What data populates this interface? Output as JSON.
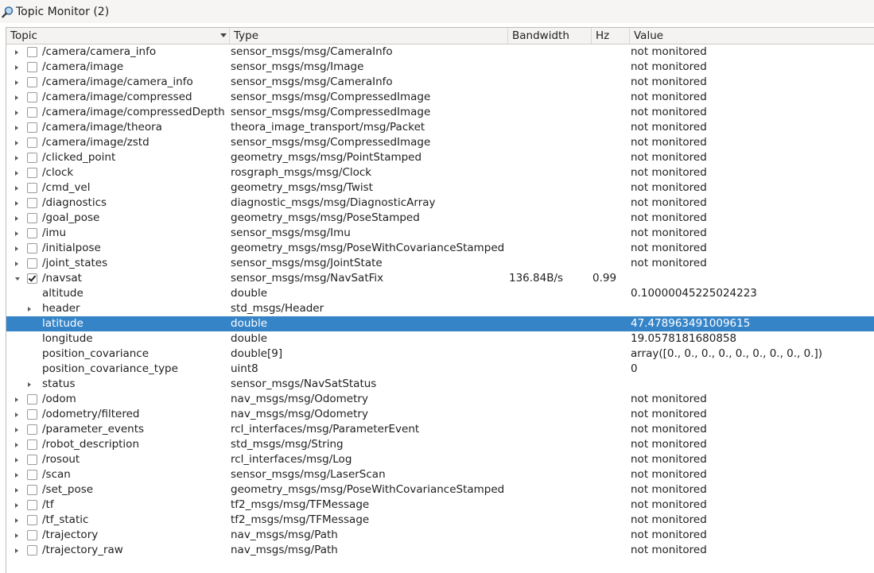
{
  "window": {
    "title": "Topic Monitor (2)",
    "icon": "magnifier-icon"
  },
  "columns": {
    "topic": "Topic",
    "type": "Type",
    "bandwidth": "Bandwidth",
    "hz": "Hz",
    "value": "Value"
  },
  "colors": {
    "selection": "#3584c8",
    "header_bg": "#f4f3f2"
  },
  "rows": [
    {
      "kind": "topic",
      "expand": "collapsed",
      "checked": false,
      "name": "/camera/camera_info",
      "type": "sensor_msgs/msg/CameraInfo",
      "bw": "",
      "hz": "",
      "value": "not monitored"
    },
    {
      "kind": "topic",
      "expand": "collapsed",
      "checked": false,
      "name": "/camera/image",
      "type": "sensor_msgs/msg/Image",
      "bw": "",
      "hz": "",
      "value": "not monitored"
    },
    {
      "kind": "topic",
      "expand": "collapsed",
      "checked": false,
      "name": "/camera/image/camera_info",
      "type": "sensor_msgs/msg/CameraInfo",
      "bw": "",
      "hz": "",
      "value": "not monitored"
    },
    {
      "kind": "topic",
      "expand": "collapsed",
      "checked": false,
      "name": "/camera/image/compressed",
      "type": "sensor_msgs/msg/CompressedImage",
      "bw": "",
      "hz": "",
      "value": "not monitored"
    },
    {
      "kind": "topic",
      "expand": "collapsed",
      "checked": false,
      "name": "/camera/image/compressedDepth",
      "type": "sensor_msgs/msg/CompressedImage",
      "bw": "",
      "hz": "",
      "value": "not monitored"
    },
    {
      "kind": "topic",
      "expand": "collapsed",
      "checked": false,
      "name": "/camera/image/theora",
      "type": "theora_image_transport/msg/Packet",
      "bw": "",
      "hz": "",
      "value": "not monitored"
    },
    {
      "kind": "topic",
      "expand": "collapsed",
      "checked": false,
      "name": "/camera/image/zstd",
      "type": "sensor_msgs/msg/CompressedImage",
      "bw": "",
      "hz": "",
      "value": "not monitored"
    },
    {
      "kind": "topic",
      "expand": "collapsed",
      "checked": false,
      "name": "/clicked_point",
      "type": "geometry_msgs/msg/PointStamped",
      "bw": "",
      "hz": "",
      "value": "not monitored"
    },
    {
      "kind": "topic",
      "expand": "collapsed",
      "checked": false,
      "name": "/clock",
      "type": "rosgraph_msgs/msg/Clock",
      "bw": "",
      "hz": "",
      "value": "not monitored"
    },
    {
      "kind": "topic",
      "expand": "collapsed",
      "checked": false,
      "name": "/cmd_vel",
      "type": "geometry_msgs/msg/Twist",
      "bw": "",
      "hz": "",
      "value": "not monitored"
    },
    {
      "kind": "topic",
      "expand": "collapsed",
      "checked": false,
      "name": "/diagnostics",
      "type": "diagnostic_msgs/msg/DiagnosticArray",
      "bw": "",
      "hz": "",
      "value": "not monitored"
    },
    {
      "kind": "topic",
      "expand": "collapsed",
      "checked": false,
      "name": "/goal_pose",
      "type": "geometry_msgs/msg/PoseStamped",
      "bw": "",
      "hz": "",
      "value": "not monitored"
    },
    {
      "kind": "topic",
      "expand": "collapsed",
      "checked": false,
      "name": "/imu",
      "type": "sensor_msgs/msg/Imu",
      "bw": "",
      "hz": "",
      "value": "not monitored"
    },
    {
      "kind": "topic",
      "expand": "collapsed",
      "checked": false,
      "name": "/initialpose",
      "type": "geometry_msgs/msg/PoseWithCovarianceStamped",
      "bw": "",
      "hz": "",
      "value": "not monitored"
    },
    {
      "kind": "topic",
      "expand": "collapsed",
      "checked": false,
      "name": "/joint_states",
      "type": "sensor_msgs/msg/JointState",
      "bw": "",
      "hz": "",
      "value": "not monitored"
    },
    {
      "kind": "topic",
      "expand": "expanded",
      "checked": true,
      "name": "/navsat",
      "type": "sensor_msgs/msg/NavSatFix",
      "bw": "136.84B/s",
      "hz": "0.99",
      "value": ""
    },
    {
      "kind": "field",
      "expand": "none",
      "name": "altitude",
      "type": "double",
      "bw": "",
      "hz": "",
      "value": "0.10000045225024223"
    },
    {
      "kind": "field",
      "expand": "collapsed",
      "name": "header",
      "type": "std_msgs/Header",
      "bw": "",
      "hz": "",
      "value": ""
    },
    {
      "kind": "field",
      "expand": "none",
      "selected": true,
      "name": "latitude",
      "type": "double",
      "bw": "",
      "hz": "",
      "value": "47.478963491009615"
    },
    {
      "kind": "field",
      "expand": "none",
      "name": "longitude",
      "type": "double",
      "bw": "",
      "hz": "",
      "value": "19.0578181680858"
    },
    {
      "kind": "field",
      "expand": "none",
      "name": "position_covariance",
      "type": "double[9]",
      "bw": "",
      "hz": "",
      "value": "array([0., 0., 0., 0., 0., 0., 0., 0., 0.])"
    },
    {
      "kind": "field",
      "expand": "none",
      "name": "position_covariance_type",
      "type": "uint8",
      "bw": "",
      "hz": "",
      "value": "0"
    },
    {
      "kind": "field",
      "expand": "collapsed",
      "name": "status",
      "type": "sensor_msgs/NavSatStatus",
      "bw": "",
      "hz": "",
      "value": ""
    },
    {
      "kind": "topic",
      "expand": "collapsed",
      "checked": false,
      "name": "/odom",
      "type": "nav_msgs/msg/Odometry",
      "bw": "",
      "hz": "",
      "value": "not monitored"
    },
    {
      "kind": "topic",
      "expand": "collapsed",
      "checked": false,
      "name": "/odometry/filtered",
      "type": "nav_msgs/msg/Odometry",
      "bw": "",
      "hz": "",
      "value": "not monitored"
    },
    {
      "kind": "topic",
      "expand": "collapsed",
      "checked": false,
      "name": "/parameter_events",
      "type": "rcl_interfaces/msg/ParameterEvent",
      "bw": "",
      "hz": "",
      "value": "not monitored"
    },
    {
      "kind": "topic",
      "expand": "collapsed",
      "checked": false,
      "name": "/robot_description",
      "type": "std_msgs/msg/String",
      "bw": "",
      "hz": "",
      "value": "not monitored"
    },
    {
      "kind": "topic",
      "expand": "collapsed",
      "checked": false,
      "name": "/rosout",
      "type": "rcl_interfaces/msg/Log",
      "bw": "",
      "hz": "",
      "value": "not monitored"
    },
    {
      "kind": "topic",
      "expand": "collapsed",
      "checked": false,
      "name": "/scan",
      "type": "sensor_msgs/msg/LaserScan",
      "bw": "",
      "hz": "",
      "value": "not monitored"
    },
    {
      "kind": "topic",
      "expand": "collapsed",
      "checked": false,
      "name": "/set_pose",
      "type": "geometry_msgs/msg/PoseWithCovarianceStamped",
      "bw": "",
      "hz": "",
      "value": "not monitored"
    },
    {
      "kind": "topic",
      "expand": "collapsed",
      "checked": false,
      "name": "/tf",
      "type": "tf2_msgs/msg/TFMessage",
      "bw": "",
      "hz": "",
      "value": "not monitored"
    },
    {
      "kind": "topic",
      "expand": "collapsed",
      "checked": false,
      "name": "/tf_static",
      "type": "tf2_msgs/msg/TFMessage",
      "bw": "",
      "hz": "",
      "value": "not monitored"
    },
    {
      "kind": "topic",
      "expand": "collapsed",
      "checked": false,
      "name": "/trajectory",
      "type": "nav_msgs/msg/Path",
      "bw": "",
      "hz": "",
      "value": "not monitored"
    },
    {
      "kind": "topic",
      "expand": "collapsed",
      "checked": false,
      "name": "/trajectory_raw",
      "type": "nav_msgs/msg/Path",
      "bw": "",
      "hz": "",
      "value": "not monitored"
    }
  ]
}
